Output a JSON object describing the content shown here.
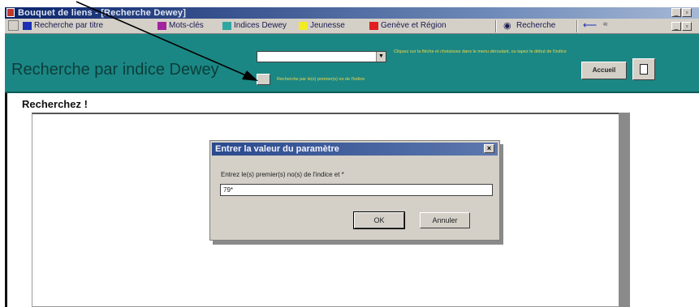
{
  "window": {
    "title": "Bouquet de liens - [Recherche Dewey]"
  },
  "toolbar": {
    "items": [
      {
        "label": "Recherche par titre",
        "color": "#1d2fb4"
      },
      {
        "label": "Mots-clés",
        "color": "#a3239f"
      },
      {
        "label": "Indices Dewey",
        "color": "#2fa6a2"
      },
      {
        "label": "Jeunesse",
        "color": "#f2ec22"
      },
      {
        "label": "Genève et Région",
        "color": "#e21f1f"
      }
    ],
    "search_label": "Recherche"
  },
  "header": {
    "title": "Recherche par indice Dewey",
    "hint": "Cliquez sur la flèche et choisissez dans le menu déroulant, ou tapez le début de l'indice",
    "search_label": "Recherche par le(s) premier(s) no de l'indice",
    "home_button": "Accueil"
  },
  "content": {
    "heading": "Recherchez !"
  },
  "dialog": {
    "title": "Entrer la valeur du paramètre",
    "prompt": "Entrez le(s) premier(s) no(s) de l'indice et *",
    "value": "79*",
    "ok_label": "OK",
    "cancel_label": "Annuler"
  },
  "colors": {
    "header_bg": "#1b8784",
    "title_bar": "#0a246a",
    "hint_text": "#f2d64a"
  }
}
